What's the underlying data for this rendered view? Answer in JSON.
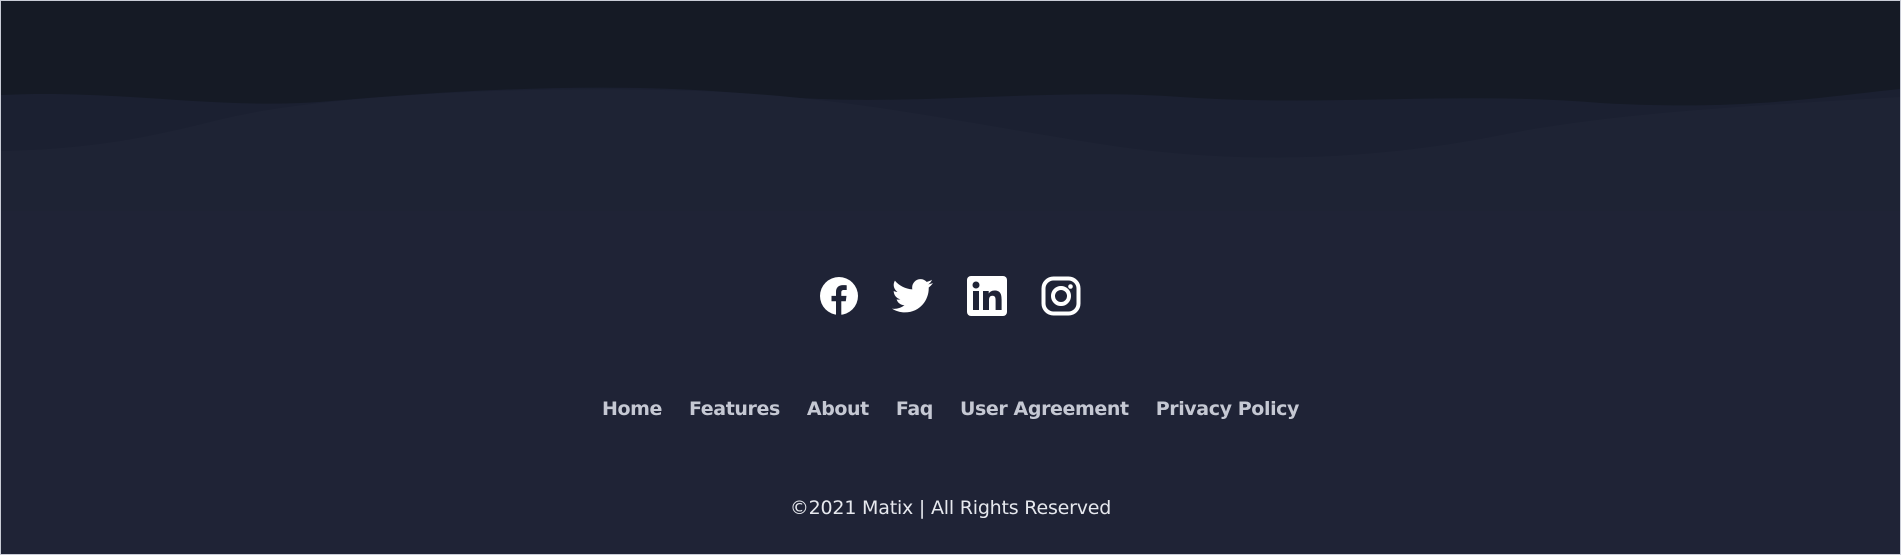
{
  "colors": {
    "background": "#1f2336",
    "top_band": "#151a25",
    "icon": "#ffffff",
    "link": "#c5c8d3",
    "copyright": "#e6e8ee"
  },
  "social": [
    {
      "name": "Facebook",
      "icon": "facebook-icon"
    },
    {
      "name": "Twitter",
      "icon": "twitter-icon"
    },
    {
      "name": "LinkedIn",
      "icon": "linkedin-icon"
    },
    {
      "name": "Instagram",
      "icon": "instagram-icon"
    }
  ],
  "nav": {
    "items": [
      {
        "label": "Home"
      },
      {
        "label": "Features"
      },
      {
        "label": "About"
      },
      {
        "label": "Faq"
      },
      {
        "label": "User Agreement"
      },
      {
        "label": "Privacy Policy"
      }
    ]
  },
  "copyright": "©2021 Matix | All Rights Reserved"
}
